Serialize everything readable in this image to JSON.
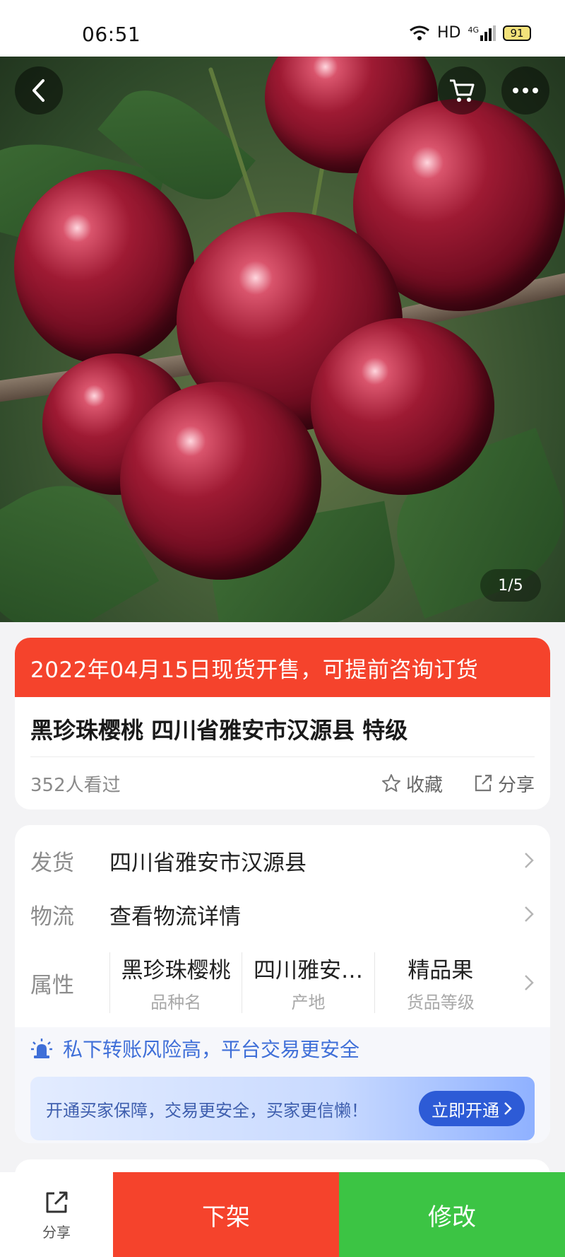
{
  "status_bar": {
    "time": "06:51",
    "network": "HD",
    "signal": "4G",
    "battery": "91"
  },
  "hero": {
    "page_indicator": "1/5"
  },
  "product": {
    "banner": "2022年04月15日现货开售，可提前咨询订货",
    "title": "黑珍珠樱桃 四川省雅安市汉源县 特级",
    "views": "352人看过",
    "favorite_label": "收藏",
    "share_label": "分享"
  },
  "details": {
    "shipping_label": "发货",
    "shipping_value": "四川省雅安市汉源县",
    "logistics_label": "物流",
    "logistics_value": "查看物流详情",
    "attributes_label": "属性",
    "attributes": [
      {
        "value": "黑珍珠樱桃",
        "key": "品种名"
      },
      {
        "value": "四川雅安…",
        "key": "产地"
      },
      {
        "value": "精品果",
        "key": "货品等级"
      }
    ]
  },
  "safety": {
    "warning": "私下转账风险高，平台交易更安全",
    "promo_text": "开通买家保障，交易更安全，买家更信懒！",
    "promo_button": "立即开通"
  },
  "bottom_bar": {
    "share_label": "分享",
    "delist_label": "下架",
    "edit_label": "修改"
  },
  "colors": {
    "accent_red": "#f5432c",
    "accent_green": "#3cc444",
    "link_blue": "#3f6fd8"
  }
}
